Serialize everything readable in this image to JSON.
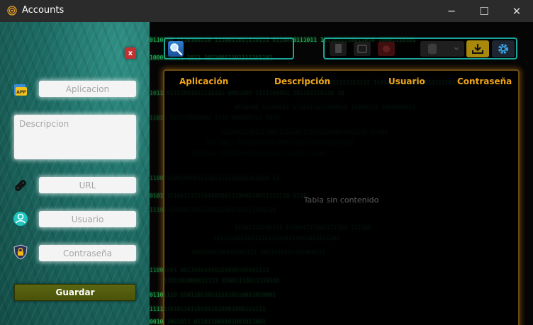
{
  "window": {
    "title": "Accounts",
    "controls": {
      "minimize": "─",
      "maximize": "☐",
      "close": "✕"
    }
  },
  "form": {
    "close_label": "x",
    "app_placeholder": "Aplicacion",
    "description_placeholder": "Descripcion",
    "url_placeholder": "URL",
    "user_placeholder": "Usuario",
    "password_placeholder": "Contraseña",
    "save_label": "Guardar",
    "icons": {
      "app": "app-icon",
      "url": "link-icon",
      "user": "user-icon",
      "password": "lock-shield-icon"
    }
  },
  "search": {
    "value": "",
    "icon": "search-icon"
  },
  "toolbar": {
    "buttons": [
      "document-icon",
      "edit-icon",
      "delete-icon",
      "database-select",
      "download-icon",
      "gear-icon"
    ],
    "colors": {
      "download": "#a8890c",
      "settings": "#1d2530",
      "accent": "#1aa89a"
    }
  },
  "table": {
    "columns": [
      "Aplicación",
      "Descripción",
      "Usuario",
      "Contraseña"
    ],
    "empty_message": "Tabla sin contenido"
  },
  "matrix": {
    "rows": [
      "0110100 1110100110 1110011011110111 0110010111011 1111011110011010 10001110101",
      "1000110011 1011 10110011101111101101",
      "10110 0110111111111111 110111010101000011111101110 0011",
      "1011 01111001011110101 0001000 1111100001 101101110110 10",
      "0110100 11101011 1110111011000011 11000111 1000100111",
      "11011 010110001001 1110 000100111 1010",
      "1111011110111100111111011101111100011011101 01101",
      "101 0011 0110101000110001101111000110011010",
      "0111011 1100110000011010111110100 11100",
      "11001110010000111101111111011101010 11",
      "0101 111011111110100100111000010011111110 0110",
      "1110111000011011101011001101111100110",
      "11101110100111 111001111001111101 111100",
      "1111111011011111111010111011011011101",
      "0001000110010101111 1011010111101000111",
      "11001001 00110010100101000100101111",
      "1101101000011111 01001110111110101",
      "01101110 1101101101111110110011010001",
      "1111010101101101011010001000111111",
      "0010 1001011 011011000101001011001"
    ]
  }
}
